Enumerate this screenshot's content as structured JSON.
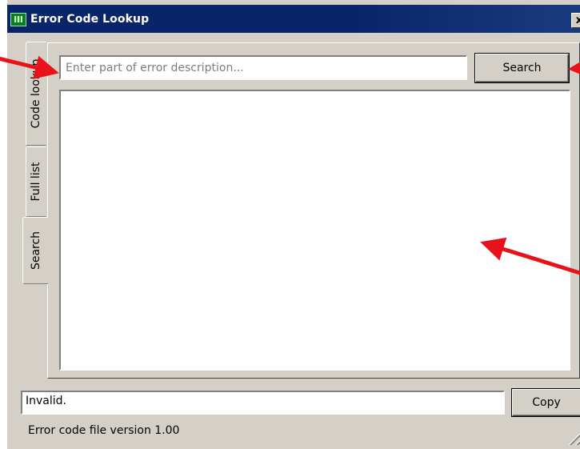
{
  "window": {
    "title": "Error Code Lookup",
    "close_glyph": "x"
  },
  "tabs": [
    {
      "label": "Code lookup",
      "active": false
    },
    {
      "label": "Full list",
      "active": false
    },
    {
      "label": "Search",
      "active": true
    }
  ],
  "search": {
    "placeholder": "Enter part of error description...",
    "value": "",
    "button_label": "Search"
  },
  "results": [],
  "status": {
    "message": "Invalid.",
    "copy_label": "Copy"
  },
  "footer": {
    "version_text": "Error code file version 1.00"
  },
  "colors": {
    "titlebar": "#0a246a",
    "window_face": "#d4d0c8",
    "annotation_arrow": "#e8121a"
  },
  "icons": {
    "app": "app-icon",
    "close": "close-icon",
    "resize": "resize-grip-icon"
  }
}
